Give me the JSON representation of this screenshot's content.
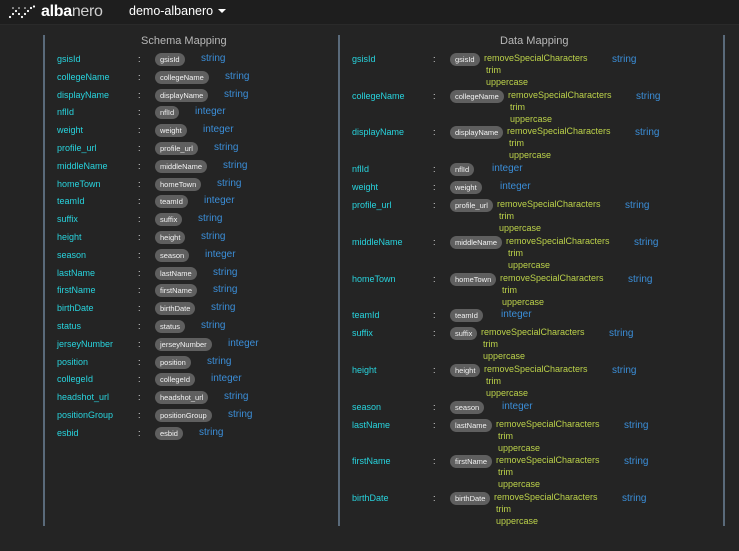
{
  "header": {
    "logo_bold": "alba",
    "logo_light": "nero",
    "project": "demo-albanero"
  },
  "schema_mapping": {
    "title": "Schema Mapping",
    "rows": [
      {
        "field": "gsisId",
        "chip": "gsisId",
        "type": "string"
      },
      {
        "field": "collegeName",
        "chip": "collegeName",
        "type": "string"
      },
      {
        "field": "displayName",
        "chip": "displayName",
        "type": "string"
      },
      {
        "field": "nflId",
        "chip": "nflId",
        "type": "integer"
      },
      {
        "field": "weight",
        "chip": "weight",
        "type": "integer"
      },
      {
        "field": "profile_url",
        "chip": "profile_url",
        "type": "string"
      },
      {
        "field": "middleName",
        "chip": "middleName",
        "type": "string"
      },
      {
        "field": "homeTown",
        "chip": "homeTown",
        "type": "string"
      },
      {
        "field": "teamId",
        "chip": "teamId",
        "type": "integer"
      },
      {
        "field": "suffix",
        "chip": "suffix",
        "type": "string"
      },
      {
        "field": "height",
        "chip": "height",
        "type": "string"
      },
      {
        "field": "season",
        "chip": "season",
        "type": "integer"
      },
      {
        "field": "lastName",
        "chip": "lastName",
        "type": "string"
      },
      {
        "field": "firstName",
        "chip": "firstName",
        "type": "string"
      },
      {
        "field": "birthDate",
        "chip": "birthDate",
        "type": "string"
      },
      {
        "field": "status",
        "chip": "status",
        "type": "string"
      },
      {
        "field": "jerseyNumber",
        "chip": "jerseyNumber",
        "type": "integer"
      },
      {
        "field": "position",
        "chip": "position",
        "type": "string"
      },
      {
        "field": "collegeId",
        "chip": "collegeId",
        "type": "integer"
      },
      {
        "field": "headshot_url",
        "chip": "headshot_url",
        "type": "string"
      },
      {
        "field": "positionGroup",
        "chip": "positionGroup",
        "type": "string"
      },
      {
        "field": "esbid",
        "chip": "esbid",
        "type": "string"
      }
    ]
  },
  "data_mapping": {
    "title": "Data Mapping",
    "rows": [
      {
        "field": "gsisId",
        "chip": "gsisId",
        "transforms": [
          "removeSpecialCharacters",
          "trim",
          "uppercase"
        ],
        "type": "string"
      },
      {
        "field": "collegeName",
        "chip": "collegeName",
        "transforms": [
          "removeSpecialCharacters",
          "trim",
          "uppercase"
        ],
        "type": "string"
      },
      {
        "field": "displayName",
        "chip": "displayName",
        "transforms": [
          "removeSpecialCharacters",
          "trim",
          "uppercase"
        ],
        "type": "string"
      },
      {
        "field": "nflId",
        "chip": "nflId",
        "transforms": [],
        "type": "integer"
      },
      {
        "field": "weight",
        "chip": "weight",
        "transforms": [],
        "type": "integer"
      },
      {
        "field": "profile_url",
        "chip": "profile_url",
        "transforms": [
          "removeSpecialCharacters",
          "trim",
          "uppercase"
        ],
        "type": "string"
      },
      {
        "field": "middleName",
        "chip": "middleName",
        "transforms": [
          "removeSpecialCharacters",
          "trim",
          "uppercase"
        ],
        "type": "string"
      },
      {
        "field": "homeTown",
        "chip": "homeTown",
        "transforms": [
          "removeSpecialCharacters",
          "trim",
          "uppercase"
        ],
        "type": "string"
      },
      {
        "field": "teamId",
        "chip": "teamId",
        "transforms": [],
        "type": "integer"
      },
      {
        "field": "suffix",
        "chip": "suffix",
        "transforms": [
          "removeSpecialCharacters",
          "trim",
          "uppercase"
        ],
        "type": "string"
      },
      {
        "field": "height",
        "chip": "height",
        "transforms": [
          "removeSpecialCharacters",
          "trim",
          "uppercase"
        ],
        "type": "string"
      },
      {
        "field": "season",
        "chip": "season",
        "transforms": [],
        "type": "integer"
      },
      {
        "field": "lastName",
        "chip": "lastName",
        "transforms": [
          "removeSpecialCharacters",
          "trim",
          "uppercase"
        ],
        "type": "string"
      },
      {
        "field": "firstName",
        "chip": "firstName",
        "transforms": [
          "removeSpecialCharacters",
          "trim",
          "uppercase"
        ],
        "type": "string"
      },
      {
        "field": "birthDate",
        "chip": "birthDate",
        "transforms": [
          "removeSpecialCharacters",
          "trim",
          "uppercase"
        ],
        "type": "string"
      }
    ]
  }
}
